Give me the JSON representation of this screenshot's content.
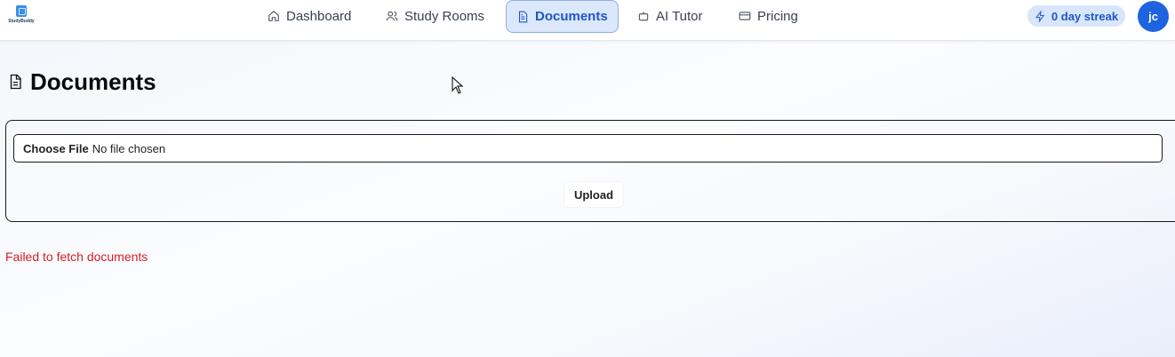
{
  "app": {
    "logo_text": "StudyBuddy"
  },
  "nav": {
    "items": [
      {
        "label": "Dashboard",
        "icon": "home-icon"
      },
      {
        "label": "Study Rooms",
        "icon": "users-icon"
      },
      {
        "label": "Documents",
        "icon": "document-icon",
        "active": true
      },
      {
        "label": "AI Tutor",
        "icon": "bot-icon"
      },
      {
        "label": "Pricing",
        "icon": "credit-card-icon"
      }
    ]
  },
  "streak": {
    "label": "0 day streak",
    "icon": "lightning-icon"
  },
  "user": {
    "initials": "jc"
  },
  "page": {
    "title": "Documents",
    "icon": "document-icon"
  },
  "upload": {
    "choose_label": "Choose File",
    "no_file_text": "No file chosen",
    "upload_label": "Upload"
  },
  "error": {
    "message": "Failed to fetch documents"
  },
  "colors": {
    "accent": "#1f56c8",
    "error": "#d21f26",
    "avatar": "#1e64e0"
  }
}
